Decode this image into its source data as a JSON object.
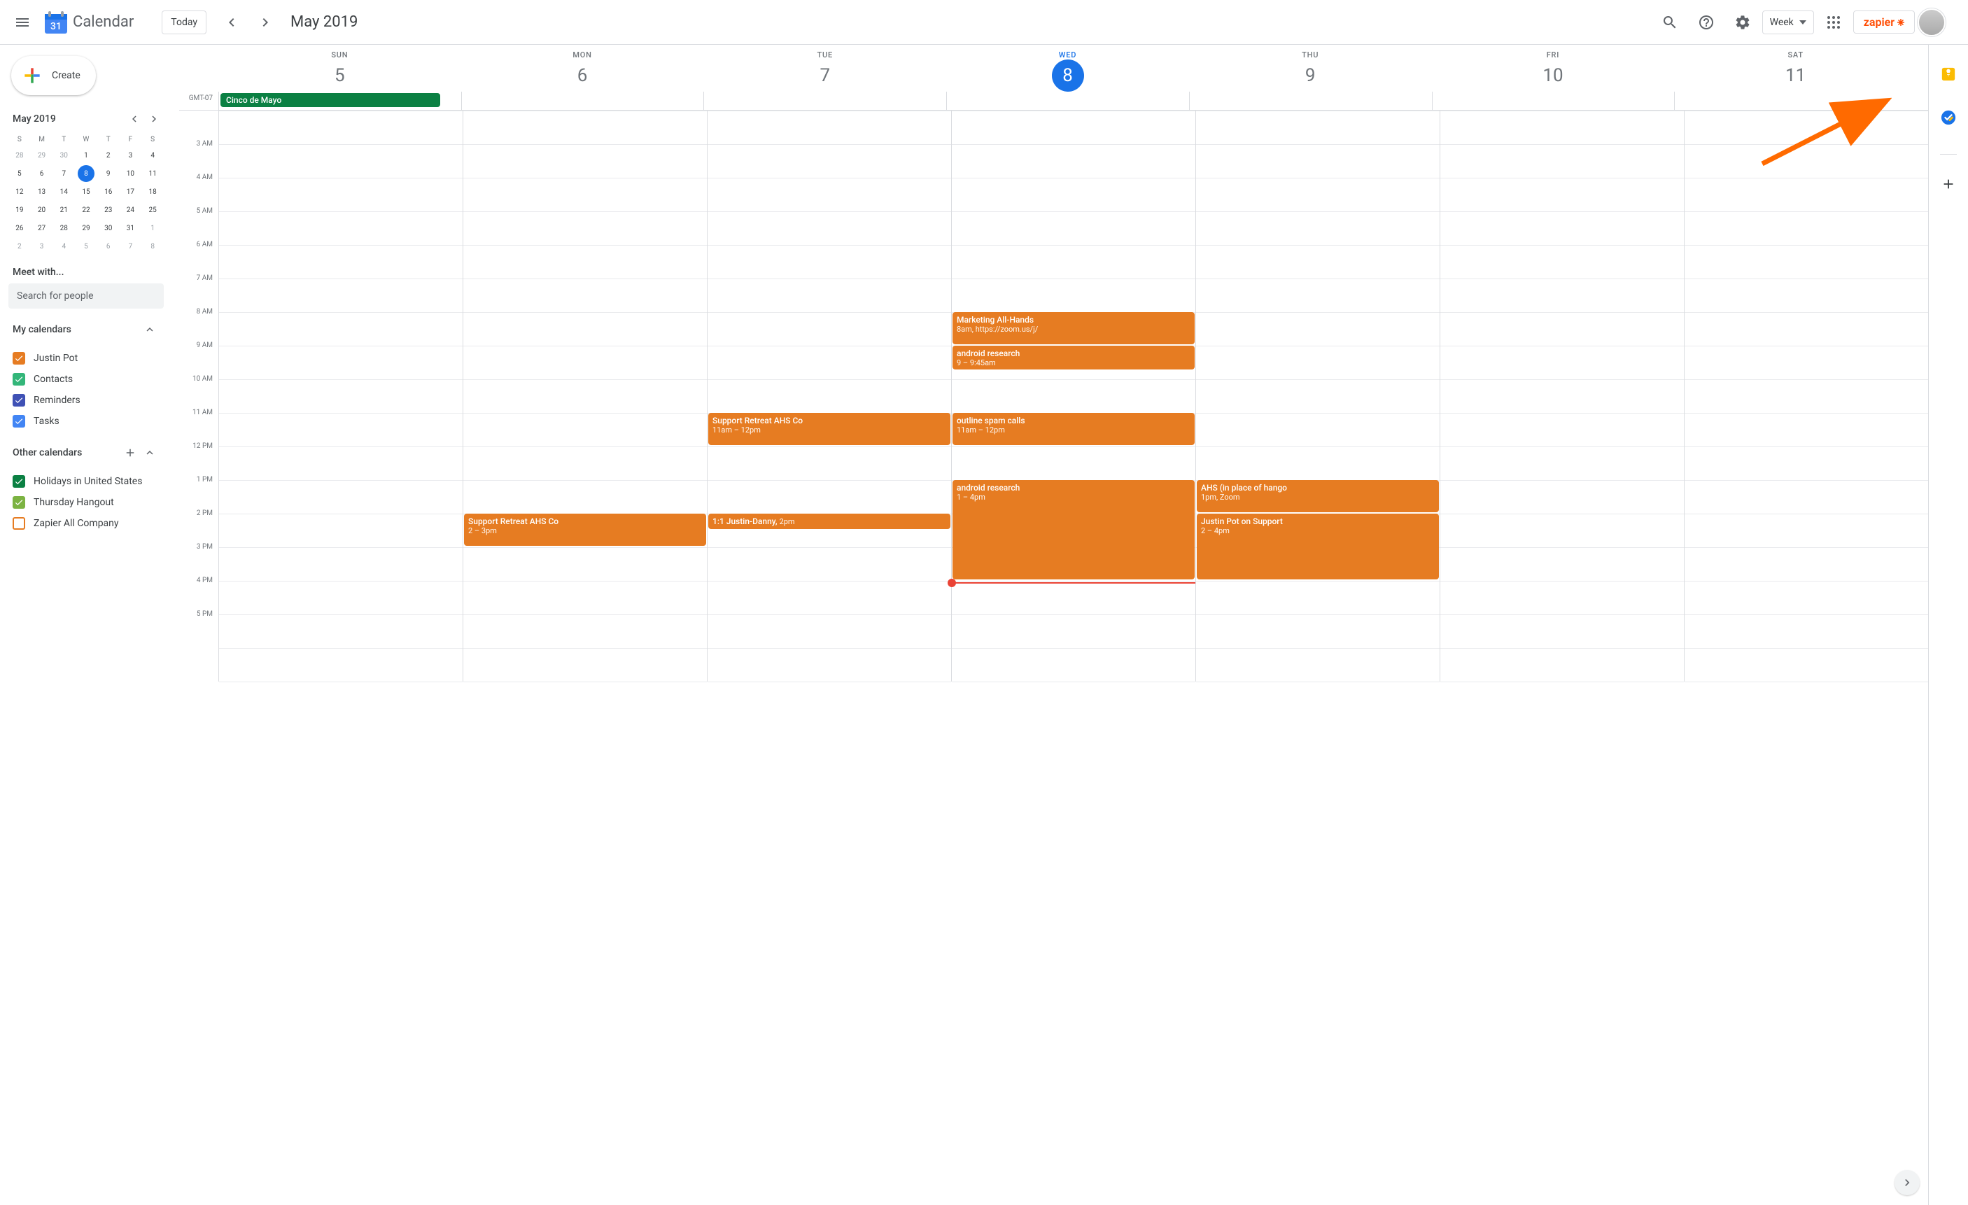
{
  "header": {
    "app_title": "Calendar",
    "logo_day_number": "31",
    "today_label": "Today",
    "month_title": "May 2019",
    "view_label": "Week",
    "zapier_label": "zapier"
  },
  "sidebar": {
    "create_label": "Create",
    "minical": {
      "title": "May 2019",
      "dows": [
        "S",
        "M",
        "T",
        "W",
        "T",
        "F",
        "S"
      ],
      "weeks": [
        [
          {
            "n": "28",
            "muted": true
          },
          {
            "n": "29",
            "muted": true
          },
          {
            "n": "30",
            "muted": true
          },
          {
            "n": "1"
          },
          {
            "n": "2"
          },
          {
            "n": "3"
          },
          {
            "n": "4"
          }
        ],
        [
          {
            "n": "5"
          },
          {
            "n": "6"
          },
          {
            "n": "7"
          },
          {
            "n": "8",
            "today": true
          },
          {
            "n": "9"
          },
          {
            "n": "10"
          },
          {
            "n": "11"
          }
        ],
        [
          {
            "n": "12"
          },
          {
            "n": "13"
          },
          {
            "n": "14"
          },
          {
            "n": "15"
          },
          {
            "n": "16"
          },
          {
            "n": "17"
          },
          {
            "n": "18"
          }
        ],
        [
          {
            "n": "19"
          },
          {
            "n": "20"
          },
          {
            "n": "21"
          },
          {
            "n": "22"
          },
          {
            "n": "23"
          },
          {
            "n": "24"
          },
          {
            "n": "25"
          }
        ],
        [
          {
            "n": "26"
          },
          {
            "n": "27"
          },
          {
            "n": "28"
          },
          {
            "n": "29"
          },
          {
            "n": "30"
          },
          {
            "n": "31"
          },
          {
            "n": "1",
            "muted": true
          }
        ],
        [
          {
            "n": "2",
            "muted": true
          },
          {
            "n": "3",
            "muted": true
          },
          {
            "n": "4",
            "muted": true
          },
          {
            "n": "5",
            "muted": true
          },
          {
            "n": "6",
            "muted": true
          },
          {
            "n": "7",
            "muted": true
          },
          {
            "n": "8",
            "muted": true
          }
        ]
      ]
    },
    "meet_with_label": "Meet with...",
    "search_placeholder": "Search for people",
    "my_calendars_label": "My calendars",
    "my_calendars": [
      {
        "label": "Justin Pot",
        "color": "#e67c22",
        "checked": true
      },
      {
        "label": "Contacts",
        "color": "#33b679",
        "checked": true
      },
      {
        "label": "Reminders",
        "color": "#3f51b5",
        "checked": true
      },
      {
        "label": "Tasks",
        "color": "#4285f4",
        "checked": true
      }
    ],
    "other_calendars_label": "Other calendars",
    "other_calendars": [
      {
        "label": "Holidays in United States",
        "color": "#0b8043",
        "checked": true
      },
      {
        "label": "Thursday Hangout",
        "color": "#7cb342",
        "checked": true
      },
      {
        "label": "Zapier All Company",
        "color": "#e67c22",
        "checked": false
      }
    ]
  },
  "week": {
    "tz_label": "GMT-07",
    "days": [
      {
        "dow": "SUN",
        "num": "5",
        "today": false
      },
      {
        "dow": "MON",
        "num": "6",
        "today": false
      },
      {
        "dow": "TUE",
        "num": "7",
        "today": false
      },
      {
        "dow": "WED",
        "num": "8",
        "today": true
      },
      {
        "dow": "THU",
        "num": "9",
        "today": false
      },
      {
        "dow": "FRI",
        "num": "10",
        "today": false
      },
      {
        "dow": "SAT",
        "num": "11",
        "today": false
      }
    ],
    "allday_events": [
      {
        "day": 0,
        "title": "Cinco de Mayo",
        "color": "#0b8043"
      }
    ],
    "time_labels": [
      "3 AM",
      "4 AM",
      "5 AM",
      "6 AM",
      "7 AM",
      "8 AM",
      "9 AM",
      "10 AM",
      "11 AM",
      "12 PM",
      "1 PM",
      "2 PM",
      "3 PM",
      "4 PM",
      "5 PM"
    ],
    "events": [
      {
        "day": 3,
        "start": 8,
        "end": 9,
        "title": "Marketing All-Hands",
        "sub": "8am, https://zoom.us/j/"
      },
      {
        "day": 3,
        "start": 9,
        "end": 9.75,
        "title": "android research",
        "sub": "9 – 9:45am"
      },
      {
        "day": 2,
        "start": 11,
        "end": 12,
        "title": "Support Retreat AHS Co",
        "sub": "11am – 12pm"
      },
      {
        "day": 3,
        "start": 11,
        "end": 12,
        "title": "outline spam calls",
        "sub": "11am – 12pm"
      },
      {
        "day": 3,
        "start": 13,
        "end": 16,
        "title": "android research",
        "sub": "1 – 4pm"
      },
      {
        "day": 4,
        "start": 13,
        "end": 14,
        "title": "AHS (in place of hango",
        "sub": "1pm, Zoom"
      },
      {
        "day": 1,
        "start": 14,
        "end": 15,
        "title": "Support Retreat AHS Co",
        "sub": "2 – 3pm"
      },
      {
        "day": 2,
        "start": 14,
        "end": 14.5,
        "title": "1:1 Justin-Danny",
        "sub": "2pm",
        "inline": true
      },
      {
        "day": 4,
        "start": 14,
        "end": 16,
        "title": "Justin Pot on Support",
        "sub": "2 – 4pm"
      }
    ],
    "now_day": 3,
    "now_hour": 16.05,
    "visible_start_hour": 2
  },
  "colors": {
    "event": "#e67c22",
    "primary": "#1a73e8",
    "holiday": "#0b8043"
  }
}
